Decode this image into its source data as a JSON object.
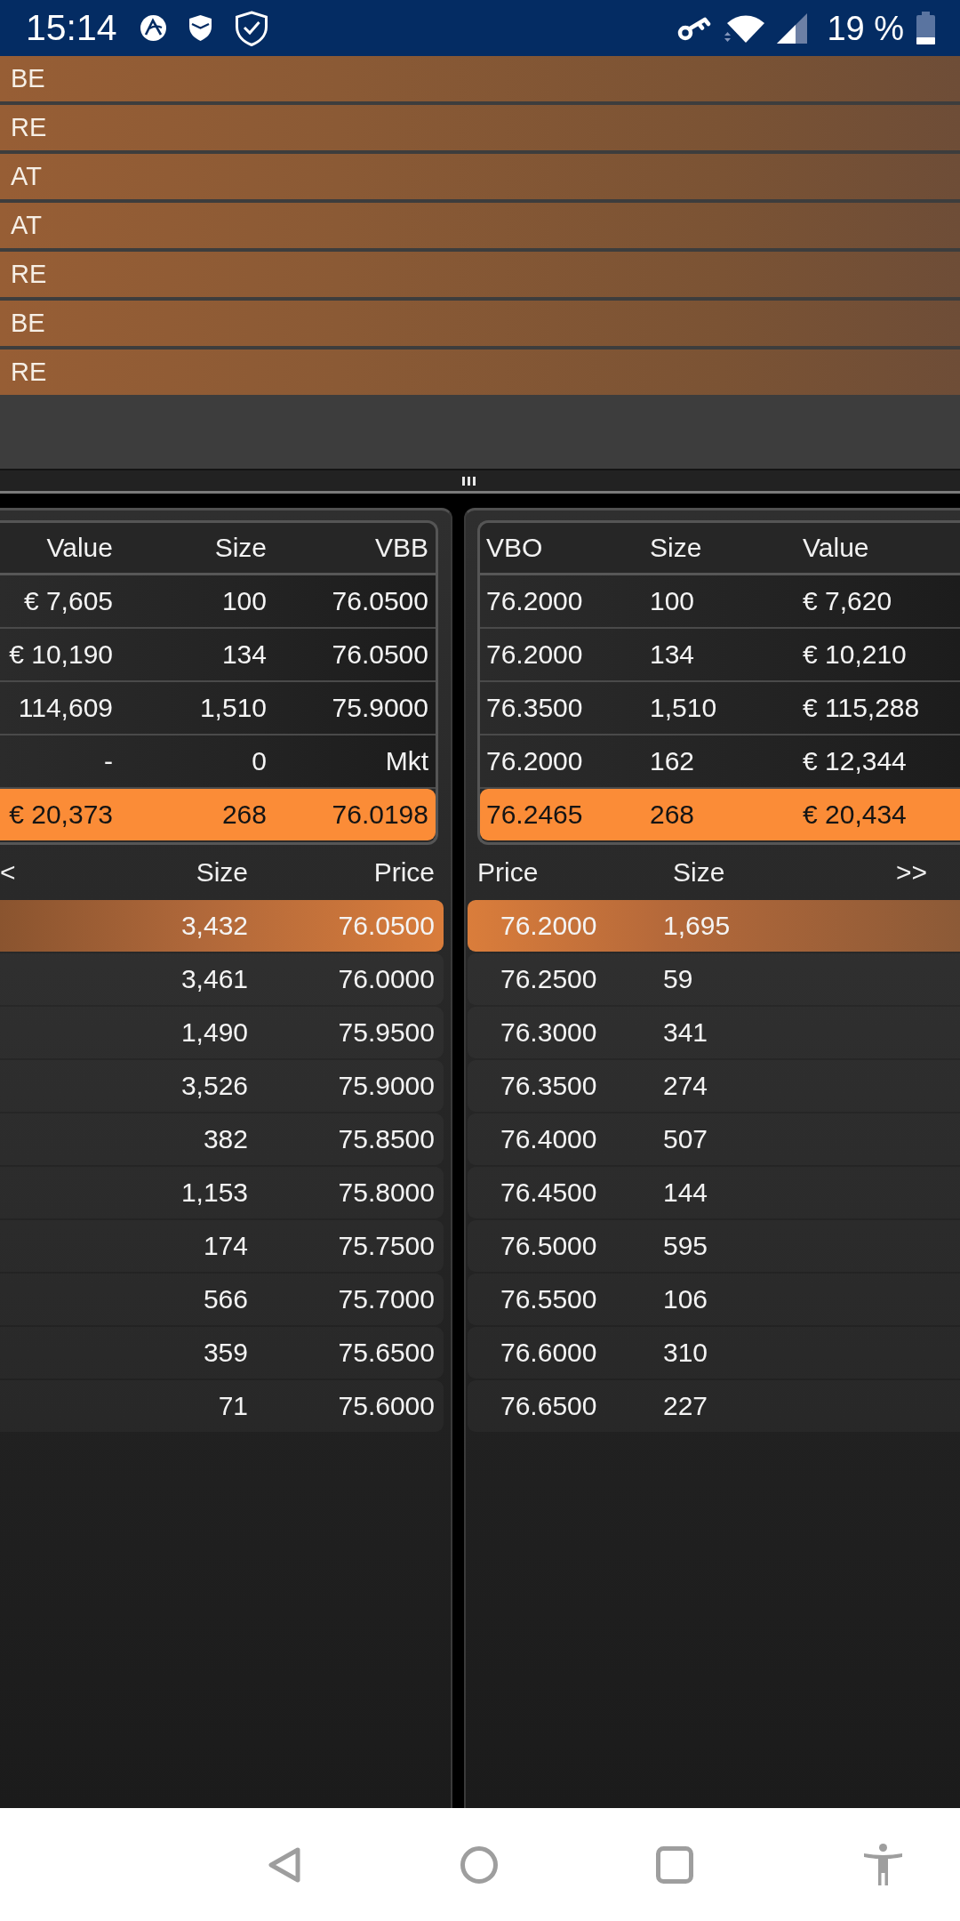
{
  "status_bar": {
    "time": "15:14",
    "battery": "19 %"
  },
  "instrument_list": {
    "items": [
      {
        "label": "BE"
      },
      {
        "label": "RE"
      },
      {
        "label": "AT"
      },
      {
        "label": "AT"
      },
      {
        "label": "RE"
      },
      {
        "label": "BE"
      },
      {
        "label": "RE"
      }
    ]
  },
  "order_book": {
    "panels": [
      {
        "kind": "bid",
        "summary": {
          "columns": [
            "Value",
            "Size",
            "VBB"
          ],
          "rows": [
            {
              "cells": [
                "€ 7,605",
                "100",
                "76.0500"
              ],
              "highlighted": false
            },
            {
              "cells": [
                "€ 10,190",
                "134",
                "76.0500"
              ],
              "highlighted": false
            },
            {
              "cells": [
                "114,609",
                "1,510",
                "75.9000"
              ],
              "highlighted": false
            },
            {
              "cells": [
                "-",
                "0",
                "Mkt"
              ],
              "highlighted": false
            },
            {
              "cells": [
                "€ 20,373",
                "268",
                "76.0198"
              ],
              "highlighted": true
            }
          ]
        },
        "depth": {
          "nav": "<",
          "columns": [
            "Size",
            "Price"
          ],
          "rows": [
            {
              "cells": [
                "3,432",
                "76.0500"
              ],
              "highlighted": true
            },
            {
              "cells": [
                "3,461",
                "76.0000"
              ],
              "highlighted": false
            },
            {
              "cells": [
                "1,490",
                "75.9500"
              ],
              "highlighted": false
            },
            {
              "cells": [
                "3,526",
                "75.9000"
              ],
              "highlighted": false
            },
            {
              "cells": [
                "382",
                "75.8500"
              ],
              "highlighted": false
            },
            {
              "cells": [
                "1,153",
                "75.8000"
              ],
              "highlighted": false
            },
            {
              "cells": [
                "174",
                "75.7500"
              ],
              "highlighted": false
            },
            {
              "cells": [
                "566",
                "75.7000"
              ],
              "highlighted": false
            },
            {
              "cells": [
                "359",
                "75.6500"
              ],
              "highlighted": false
            },
            {
              "cells": [
                "71",
                "75.6000"
              ],
              "highlighted": false
            }
          ]
        }
      },
      {
        "kind": "ask",
        "summary": {
          "columns": [
            "VBO",
            "Size",
            "Value"
          ],
          "rows": [
            {
              "cells": [
                "76.2000",
                "100",
                "€ 7,620"
              ],
              "highlighted": false
            },
            {
              "cells": [
                "76.2000",
                "134",
                "€ 10,210"
              ],
              "highlighted": false
            },
            {
              "cells": [
                "76.3500",
                "1,510",
                "€ 115,288"
              ],
              "highlighted": false
            },
            {
              "cells": [
                "76.2000",
                "162",
                "€ 12,344"
              ],
              "highlighted": false
            },
            {
              "cells": [
                "76.2465",
                "268",
                "€ 20,434"
              ],
              "highlighted": true
            }
          ]
        },
        "depth": {
          "nav": ">>",
          "columns": [
            "Price",
            "Size"
          ],
          "rows": [
            {
              "cells": [
                "76.2000",
                "1,695"
              ],
              "highlighted": true
            },
            {
              "cells": [
                "76.2500",
                "59"
              ],
              "highlighted": false
            },
            {
              "cells": [
                "76.3000",
                "341"
              ],
              "highlighted": false
            },
            {
              "cells": [
                "76.3500",
                "274"
              ],
              "highlighted": false
            },
            {
              "cells": [
                "76.4000",
                "507"
              ],
              "highlighted": false
            },
            {
              "cells": [
                "76.4500",
                "144"
              ],
              "highlighted": false
            },
            {
              "cells": [
                "76.5000",
                "595"
              ],
              "highlighted": false
            },
            {
              "cells": [
                "76.5500",
                "106"
              ],
              "highlighted": false
            },
            {
              "cells": [
                "76.6000",
                "310"
              ],
              "highlighted": false
            },
            {
              "cells": [
                "76.6500",
                "227"
              ],
              "highlighted": false
            }
          ]
        }
      }
    ]
  }
}
